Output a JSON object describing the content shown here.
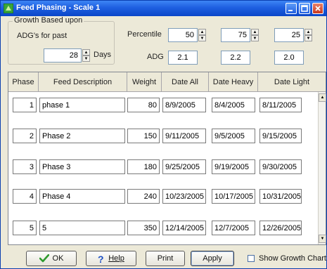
{
  "window": {
    "title": "Feed Phasing - Scale 1",
    "title_color": "#1e5fe0",
    "controls": [
      "minimize-icon",
      "maximize-icon",
      "close-icon"
    ]
  },
  "growth_group": {
    "legend": "Growth Based upon",
    "adg_label": "ADG's for past",
    "days_value": "28",
    "days_unit": "Days"
  },
  "percentile": {
    "label": "Percentile",
    "values": [
      "50",
      "75",
      "25"
    ]
  },
  "adg": {
    "label": "ADG",
    "values": [
      "2.1",
      "2.2",
      "2.0"
    ]
  },
  "grid": {
    "headers": [
      "Phase",
      "Feed Description",
      "Weight",
      "Date All",
      "Date Heavy",
      "Date Light"
    ],
    "rows": [
      {
        "phase": "1",
        "description": "phase 1",
        "weight": "80",
        "date_all": "8/9/2005",
        "date_heavy": "8/4/2005",
        "date_light": "8/11/2005"
      },
      {
        "phase": "2",
        "description": "Phase 2",
        "weight": "150",
        "date_all": "9/11/2005",
        "date_heavy": "9/5/2005",
        "date_light": "9/15/2005"
      },
      {
        "phase": "3",
        "description": "Phase 3",
        "weight": "180",
        "date_all": "9/25/2005",
        "date_heavy": "9/19/2005",
        "date_light": "9/30/2005"
      },
      {
        "phase": "4",
        "description": "Phase 4",
        "weight": "240",
        "date_all": "10/23/2005",
        "date_heavy": "10/17/2005",
        "date_light": "10/31/2005"
      },
      {
        "phase": "5",
        "description": "5",
        "weight": "350",
        "date_all": "12/14/2005",
        "date_heavy": "12/7/2005",
        "date_light": "12/26/2005"
      }
    ]
  },
  "buttons": {
    "ok": "OK",
    "help": "Help",
    "print": "Print",
    "apply": "Apply",
    "show_growth_chart": "Show Growth Chart"
  },
  "icons": {
    "ok": "checkmark-icon",
    "help": "question-mark-icon"
  },
  "colors": {
    "ok_icon": "#2e9a2e",
    "help_icon": "#1c4fc4"
  }
}
